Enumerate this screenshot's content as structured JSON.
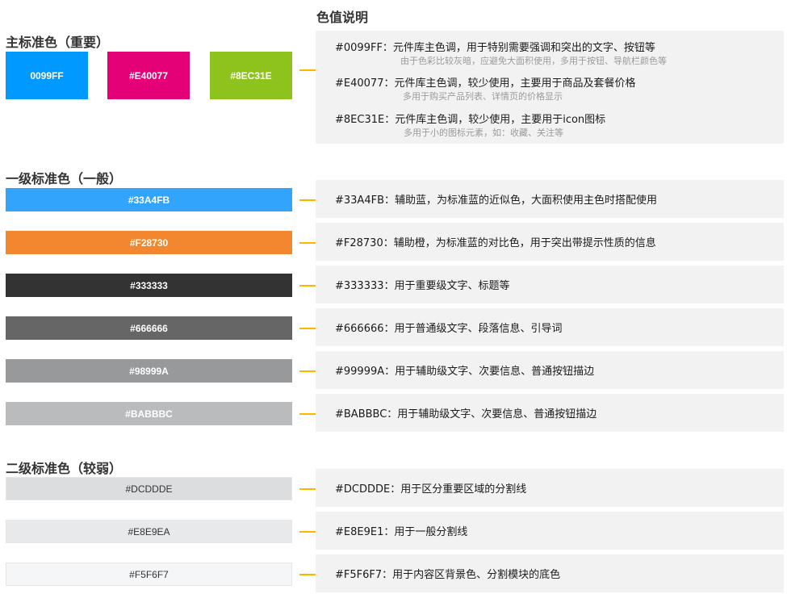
{
  "heading": "色值说明",
  "primary": {
    "title": "主标准色（重要）",
    "swatches": [
      {
        "label": "0099FF",
        "color": "#0099FF"
      },
      {
        "label": "#E40077",
        "color": "#E40077"
      },
      {
        "label": "#8EC31E",
        "color": "#8EC31E"
      }
    ],
    "descriptions": [
      {
        "main": "#0099FF：元件库主色调，用于特别需要强调和突出的文字、按钮等",
        "sub": "由于色彩比较灰暗，应避免大面积使用，多用于按钮、导航栏颜色等"
      },
      {
        "main": "#E40077：元件库主色调，较少使用，主要用于商品及套餐价格",
        "sub": "多用于购买产品列表、详情页的价格显示"
      },
      {
        "main": "#8EC31E：元件库主色调，较少使用，主要用于icon图标",
        "sub": "多用于小的图标元素，如：收藏、关注等"
      }
    ]
  },
  "secondary": {
    "title": "一级标准色（一般）",
    "rows": [
      {
        "label": "#33A4FB",
        "color": "#33A4FB",
        "desc": "#33A4FB：辅助蓝，为标准蓝的近似色，大面积使用主色时搭配使用"
      },
      {
        "label": "#F28730",
        "color": "#F28730",
        "desc": "#F28730：辅助橙，为标准蓝的对比色，用于突出带提示性质的信息"
      },
      {
        "label": "#333333",
        "color": "#333333",
        "desc": "#333333：用于重要级文字、标题等"
      },
      {
        "label": "#666666",
        "color": "#666666",
        "desc": "#666666：用于普通级文字、段落信息、引导词"
      },
      {
        "label": "#98999A",
        "color": "#98999A",
        "desc": "#99999A：用于辅助级文字、次要信息、普通按钮描边"
      },
      {
        "label": "#BABBBC",
        "color": "#BABBBC",
        "desc": "#BABBBC：用于辅助级文字、次要信息、普通按钮描边"
      }
    ]
  },
  "tertiary": {
    "title": "二级标准色（较弱）",
    "rows": [
      {
        "label": "#DCDDDE",
        "color": "#DCDDDE",
        "desc": "#DCDDDE：用于区分重要区域的分割线"
      },
      {
        "label": "#E8E9EA",
        "color": "#E8E9EA",
        "desc": "#E8E9E1：用于一般分割线"
      },
      {
        "label": "#F5F6F7",
        "color": "#F5F6F7",
        "desc": "#F5F6F7：用于内容区背景色、分割模块的底色"
      }
    ]
  },
  "colors": {
    "arrow": "#FFB400",
    "panel": "#F2F2F2"
  },
  "icons": {
    "arrow": "arrow-right-icon"
  }
}
